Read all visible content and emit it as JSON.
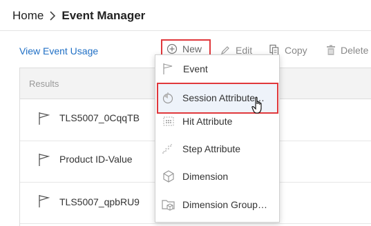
{
  "breadcrumb": {
    "home": "Home",
    "current": "Event Manager"
  },
  "view_link": "View Event Usage",
  "toolbar": {
    "new_label": "New",
    "edit_label": "Edit",
    "copy_label": "Copy",
    "delete_label": "Delete"
  },
  "results": {
    "header": "Results",
    "rows": [
      {
        "label": "TLS5007_0CqqTB",
        "icon": "flag-icon"
      },
      {
        "label": "Product ID-Value",
        "icon": "flag-icon"
      },
      {
        "label": "TLS5007_qpbRU9",
        "icon": "flag-icon"
      }
    ]
  },
  "new_menu": {
    "items": [
      {
        "label": "Event",
        "icon": "flag-icon"
      },
      {
        "label": "Session Attribute…",
        "icon": "session-attribute-icon",
        "highlighted": true
      },
      {
        "label": "Hit Attribute",
        "icon": "hit-attribute-icon"
      },
      {
        "label": "Step Attribute",
        "icon": "step-attribute-icon"
      },
      {
        "label": "Dimension",
        "icon": "cube-icon"
      },
      {
        "label": "Dimension Group…",
        "icon": "dimension-group-icon"
      }
    ]
  },
  "colors": {
    "link": "#1f6fc5",
    "highlight_border": "#e0373b",
    "header_bg": "#f3f3f3",
    "muted_text": "#888888"
  }
}
